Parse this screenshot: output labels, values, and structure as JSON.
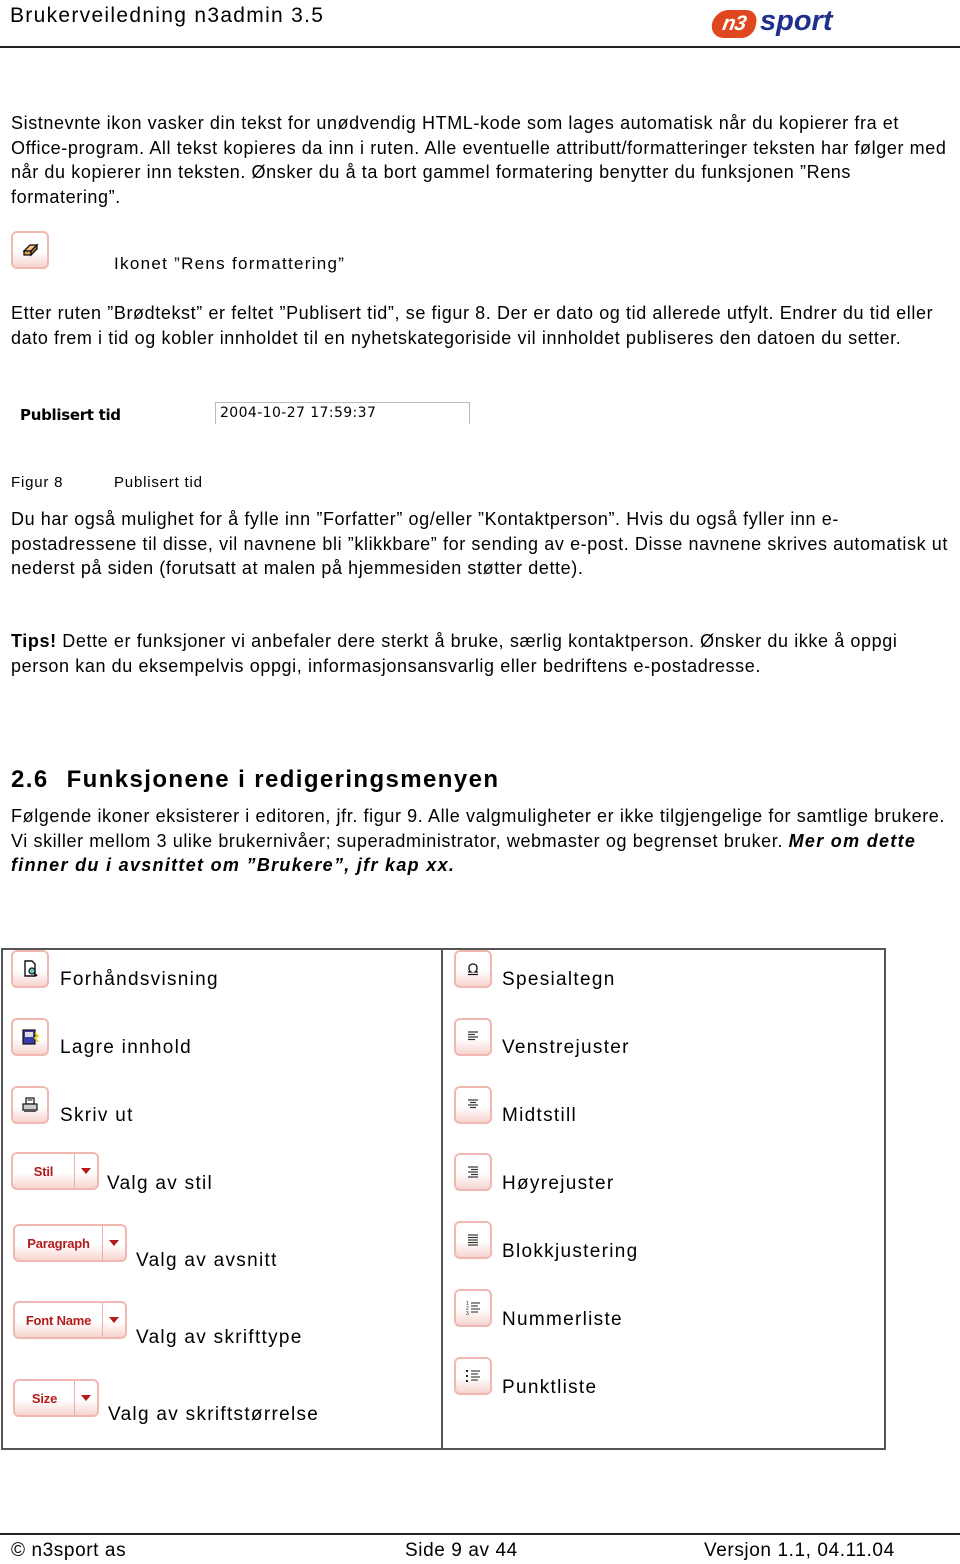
{
  "header": {
    "title": "Brukerveiledning n3admin 3.5",
    "logo": {
      "badge": "n3",
      "text": "sport",
      "badge_color": "#e0471f",
      "text_color": "#1e2f8c"
    }
  },
  "paragraphs": {
    "p1": "Sistnevnte ikon vasker din tekst for unødvendig HTML-kode som lages automatisk når du kopierer fra et Office-program. All tekst kopieres da inn i ruten. Alle eventuelle attributt/formatteringer teksten har følger med når du kopierer inn teksten. Ønsker du å ta bort gammel formatering benytter du funksjonen ”Rens formatering”.",
    "icon_caption": "Ikonet ”Rens formattering”",
    "icon_name": "eraser-icon",
    "p2": "Etter ruten ”Brødtekst” er feltet ”Publisert tid”, se figur 8. Der er dato og tid allerede utfylt. Endrer du tid eller dato frem i tid og kobler innholdet til en nyhetskategoriside vil innholdet publiseres den datoen du setter.",
    "p3": "Du har også mulighet for å fylle inn ”Forfatter” og/eller ”Kontaktperson”. Hvis du også fyller inn e-postadressene til disse, vil navnene bli ”klikkbare” for sending av e-post. Disse navnene skrives automatisk ut nederst på siden (forutsatt at malen på hjemmesiden støtter dette).",
    "tips_label": "Tips!",
    "tips_text": " Dette er funksjoner vi anbefaler dere sterkt å bruke, særlig kontaktperson. Ønsker du ikke å oppgi person kan du eksempelvis oppgi, informasjonsansvarlig eller bedriftens e-postadresse."
  },
  "figure8": {
    "field_label": "Publisert tid",
    "field_value": "2004-10-27 17:59:37",
    "caption_number": "Figur 8",
    "caption_text": "Publisert tid"
  },
  "section": {
    "number": "2.6",
    "title": "Funksjonene i redigeringsmenyen",
    "body": "Følgende ikoner eksisterer i editoren, jfr. figur 9. Alle valgmuligheter er ikke tilgjengelige for samtlige brukere. Vi skiller mellom 3 ulike brukernivåer; superadministrator, webmaster og begrenset bruker. ",
    "body_emphasis": "Mer om dette finner du i avsnittet om ”Brukere”, jfr kap xx."
  },
  "icon_table": {
    "left": [
      {
        "label": "Forhåndsvisning",
        "icon": "preview-icon"
      },
      {
        "label": "Lagre innhold",
        "icon": "save-icon"
      },
      {
        "label": "Skriv ut",
        "icon": "print-icon"
      },
      {
        "label": "Valg av stil",
        "dropdown": "Stil"
      },
      {
        "label": "Valg av avsnitt",
        "dropdown": "Paragraph"
      },
      {
        "label": "Valg av skrifttype",
        "dropdown": "Font Name"
      },
      {
        "label": "Valg av skriftstørrelse",
        "dropdown": "Size"
      }
    ],
    "right": [
      {
        "label": "Spesialtegn",
        "icon": "omega-icon"
      },
      {
        "label": "Venstrejuster",
        "icon": "align-left-icon"
      },
      {
        "label": "Midtstill",
        "icon": "align-center-icon"
      },
      {
        "label": "Høyrejuster",
        "icon": "align-right-icon"
      },
      {
        "label": "Blokkjustering",
        "icon": "align-justify-icon"
      },
      {
        "label": "Nummerliste",
        "icon": "numbered-list-icon"
      },
      {
        "label": "Punktliste",
        "icon": "bullet-list-icon"
      }
    ]
  },
  "footer": {
    "copyright": "© n3sport as",
    "page": "Side 9 av 44",
    "version": "Versjon 1.1, 04.11.04"
  }
}
